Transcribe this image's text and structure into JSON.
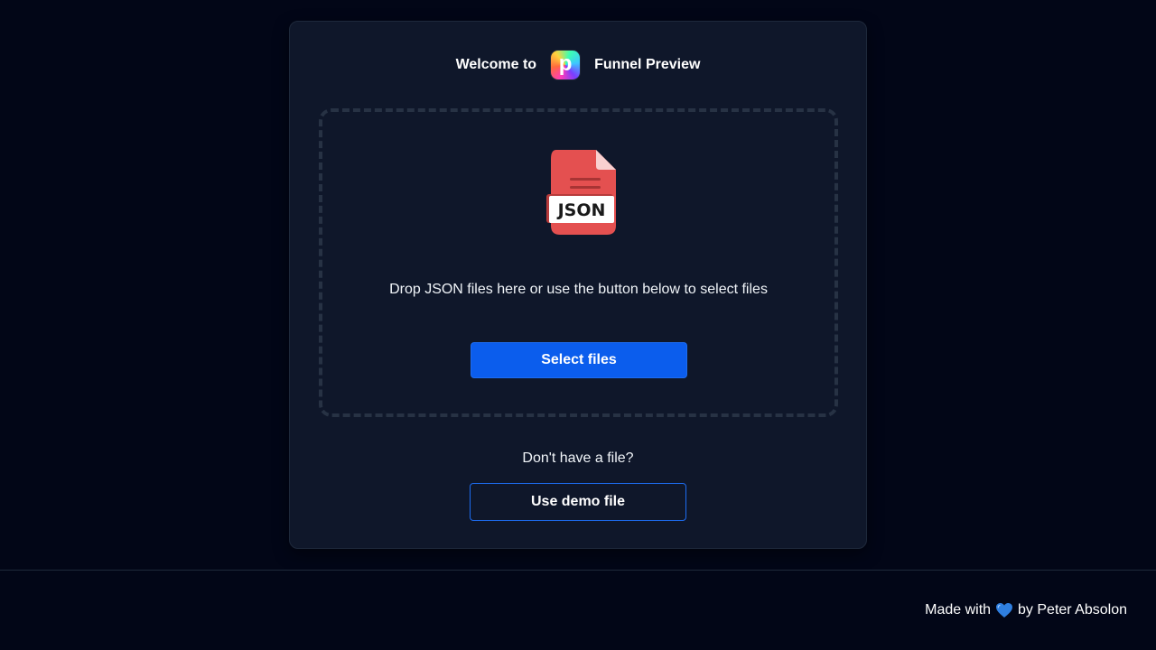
{
  "header": {
    "welcome_prefix": "Welcome to",
    "logo_letter": "p",
    "app_name": "Funnel Preview"
  },
  "dropzone": {
    "file_icon_label": "JSON",
    "instruction": "Drop JSON files here or use the button below to select files",
    "select_button_label": "Select files"
  },
  "demo": {
    "prompt": "Don't have a file?",
    "button_label": "Use demo file"
  },
  "footer": {
    "made_with": "Made with",
    "heart_icon": "blue-heart-icon",
    "by": "by Peter Absolon"
  },
  "colors": {
    "background": "#020617",
    "card": "#0f172a",
    "primary": "#0b5ded",
    "file_icon": "#e45050"
  }
}
